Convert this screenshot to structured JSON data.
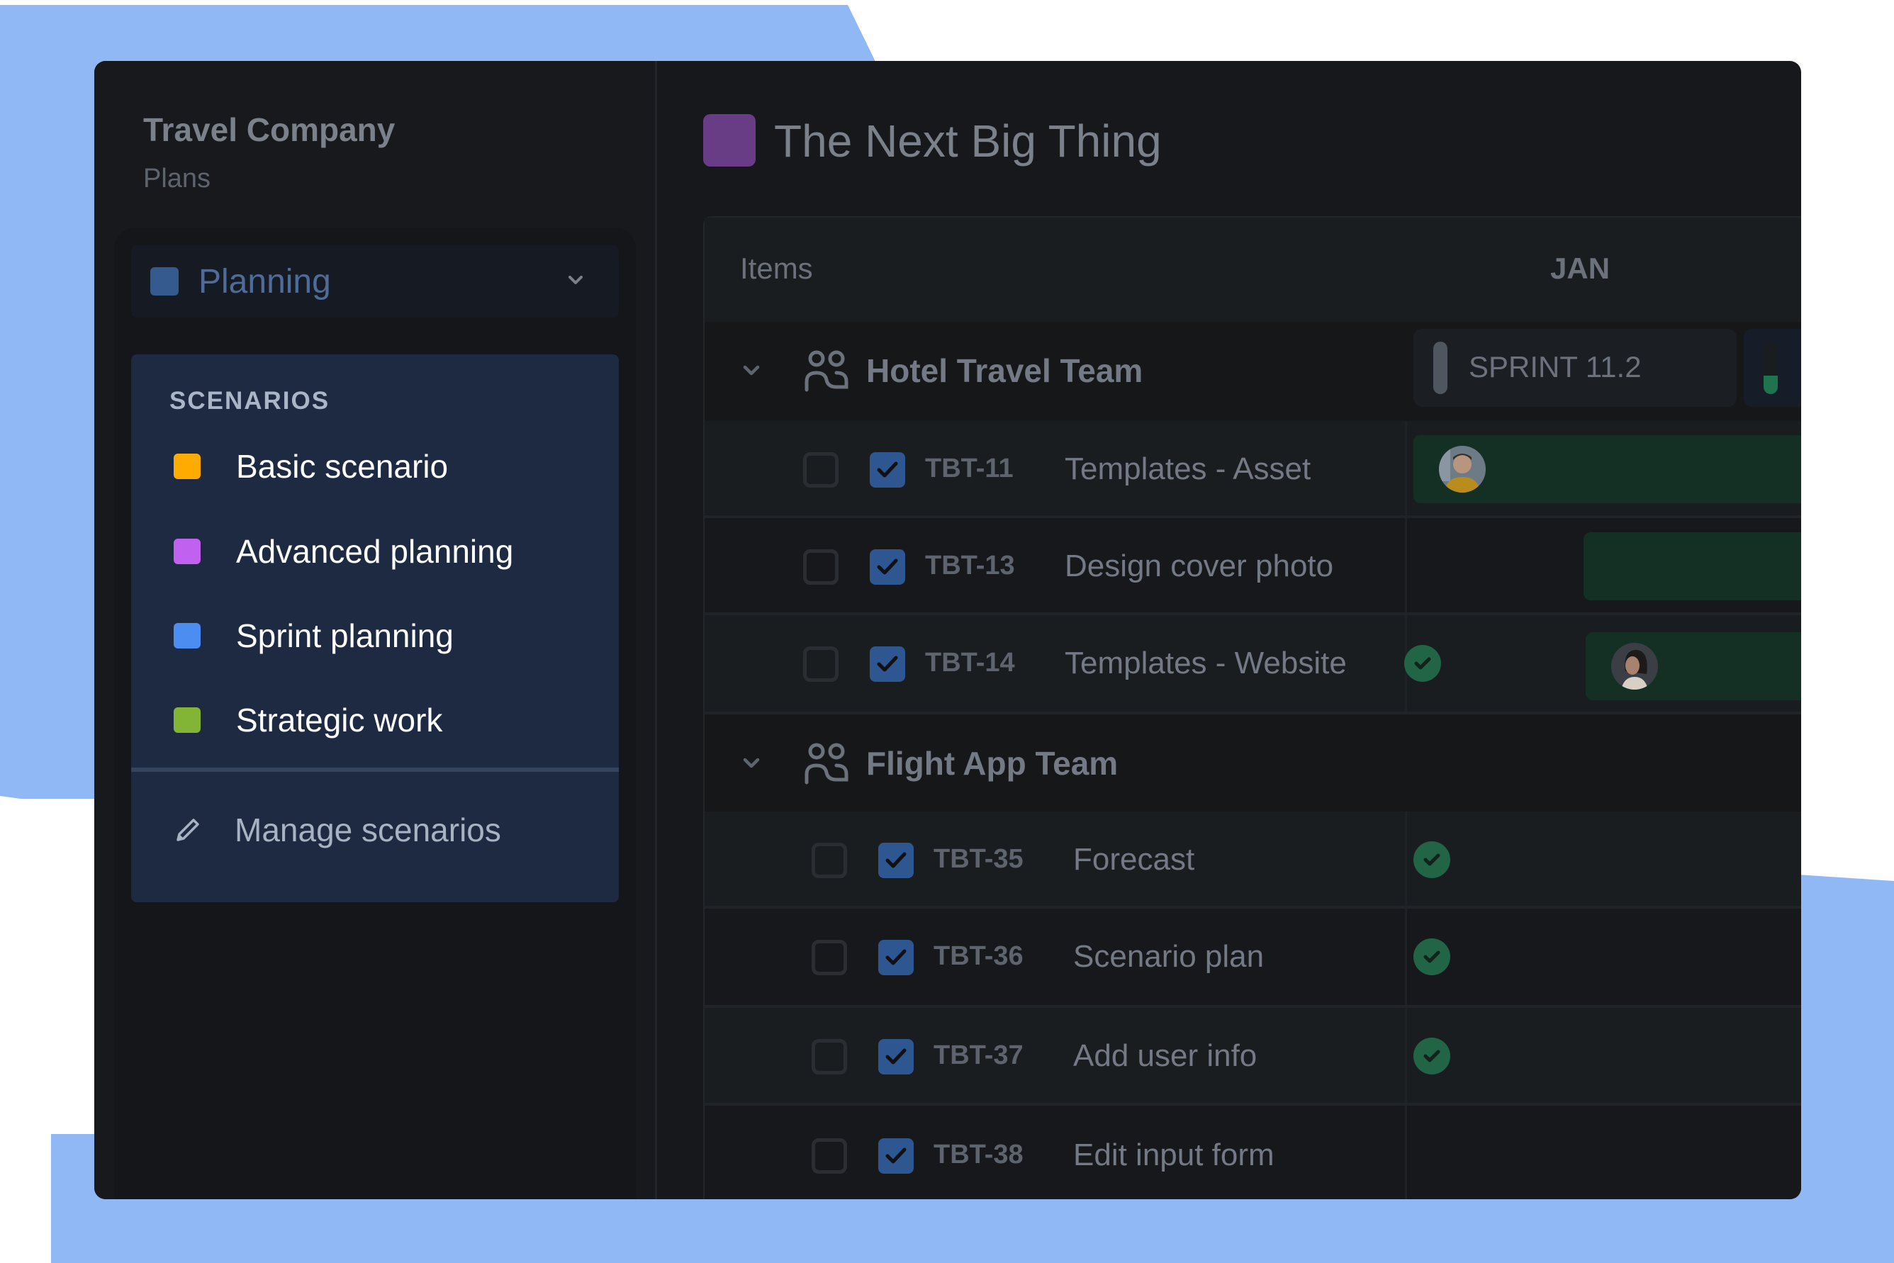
{
  "sidebar": {
    "org_title": "Travel Company",
    "org_subtitle": "Plans",
    "plan_dropdown": {
      "label": "Planning",
      "swatch_color": "#355a8e",
      "icon": "chevron-down-icon"
    },
    "scenarios": {
      "heading": "SCENARIOS",
      "items": [
        {
          "label": "Basic scenario",
          "color": "#ffab00"
        },
        {
          "label": "Advanced planning",
          "color": "#c061f0"
        },
        {
          "label": "Sprint planning",
          "color": "#4c8df2"
        },
        {
          "label": "Strategic work",
          "color": "#82b536"
        }
      ],
      "manage_label": "Manage scenarios",
      "manage_icon": "pencil-icon"
    }
  },
  "main": {
    "title": "The Next Big Thing",
    "title_swatch_color": "#683d85",
    "table": {
      "items_header": "Items",
      "month_header": "JAN",
      "sprint_label": "SPRINT 11.2",
      "next_sprint_progress": 0.35,
      "teams": [
        {
          "name": "Hotel Travel Team",
          "icon": "people-icon",
          "items": [
            {
              "key": "TBT-11",
              "title": "Templates - Asset",
              "selected": false,
              "checked": true,
              "done": false,
              "has_bar": true,
              "avatar": "man-avatar"
            },
            {
              "key": "TBT-13",
              "title": "Design cover photo",
              "selected": false,
              "checked": true,
              "done": false,
              "has_bar": true,
              "avatar": null
            },
            {
              "key": "TBT-14",
              "title": "Templates - Website",
              "selected": false,
              "checked": true,
              "done": true,
              "has_bar": true,
              "avatar": "woman-avatar"
            }
          ]
        },
        {
          "name": "Flight App Team",
          "icon": "people-icon",
          "items": [
            {
              "key": "TBT-35",
              "title": "Forecast",
              "selected": false,
              "checked": true,
              "done": true
            },
            {
              "key": "TBT-36",
              "title": "Scenario plan",
              "selected": false,
              "checked": true,
              "done": true
            },
            {
              "key": "TBT-37",
              "title": "Add user info",
              "selected": false,
              "checked": true,
              "done": true
            },
            {
              "key": "TBT-38",
              "title": "Edit input form",
              "selected": false,
              "checked": true,
              "done": false
            }
          ]
        }
      ]
    }
  }
}
